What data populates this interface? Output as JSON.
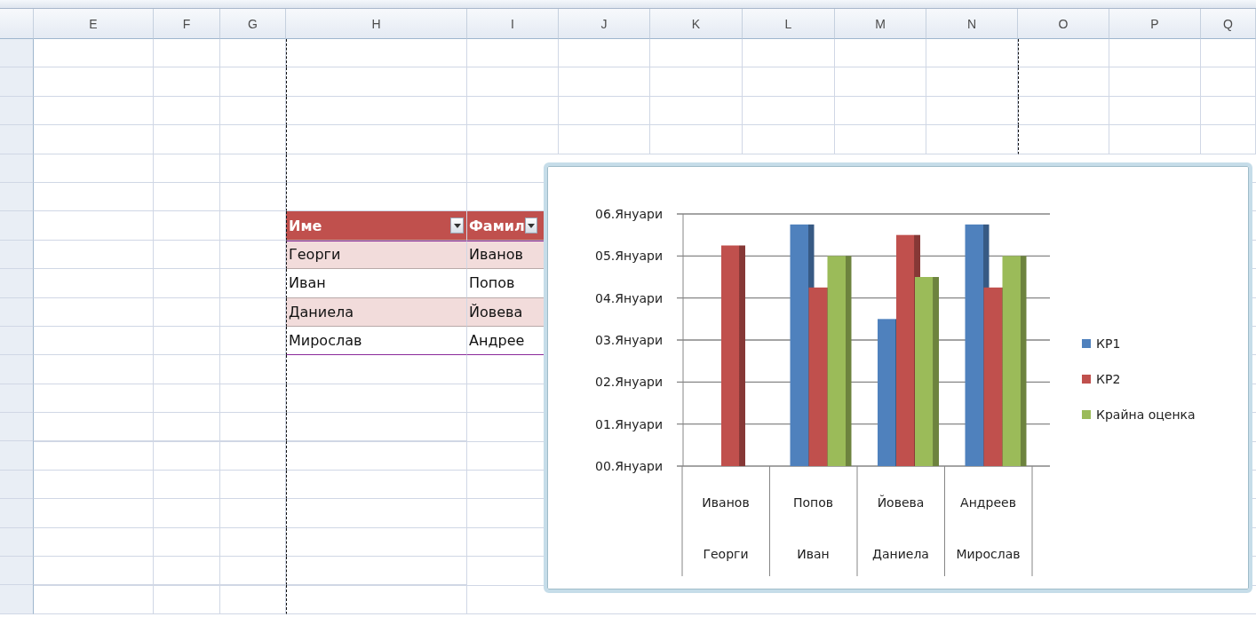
{
  "column_headers": [
    "E",
    "F",
    "G",
    "H",
    "I",
    "J",
    "K",
    "L",
    "M",
    "N",
    "O",
    "P",
    "Q"
  ],
  "table": {
    "columns": [
      "Име",
      "Фамил"
    ],
    "rows": [
      [
        "Георги",
        "Иванов"
      ],
      [
        "Иван",
        "Попов"
      ],
      [
        "Даниела",
        "Йовева"
      ],
      [
        "Мирослав",
        "Андрее"
      ]
    ]
  },
  "chart": {
    "second_line_labels": [
      "Георги",
      "Иван",
      "Даниела",
      "Мирослав"
    ],
    "chart_data": {
      "type": "bar",
      "categories": [
        "Иванов",
        "Попов",
        "Йовева",
        "Андреев"
      ],
      "series": [
        {
          "name": "КР1",
          "color": "#4f81bd",
          "values": [
            null,
            5.75,
            3.5,
            5.75
          ]
        },
        {
          "name": "КР2",
          "color": "#c0504d",
          "values": [
            5.25,
            4.25,
            5.5,
            4.25
          ]
        },
        {
          "name": "Крайна оценка",
          "color": "#9bbb59",
          "values": [
            null,
            5.0,
            4.5,
            5.0
          ]
        }
      ],
      "ylim": [
        0,
        6
      ],
      "grid": true,
      "legend": true,
      "yticks": [
        {
          "value": 0,
          "label": "00.Януари"
        },
        {
          "value": 1,
          "label": "01.Януари"
        },
        {
          "value": 2,
          "label": "02.Януари"
        },
        {
          "value": 3,
          "label": "03.Януари"
        },
        {
          "value": 4,
          "label": "04.Януари"
        },
        {
          "value": 5,
          "label": "05.Януари"
        },
        {
          "value": 6,
          "label": "06.Януари"
        }
      ]
    }
  }
}
